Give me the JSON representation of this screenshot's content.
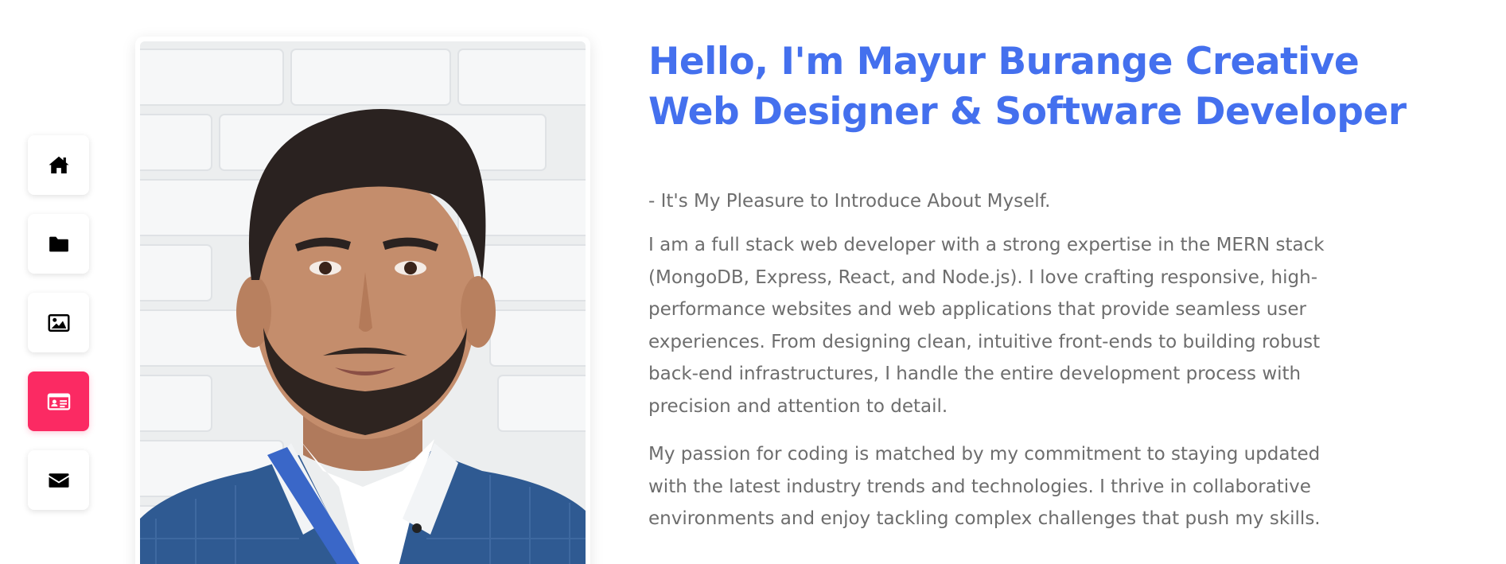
{
  "nav": {
    "items": [
      {
        "icon": "home-icon",
        "active": false
      },
      {
        "icon": "folder-icon",
        "active": false
      },
      {
        "icon": "image-icon",
        "active": false
      },
      {
        "icon": "id-card-icon",
        "active": true
      },
      {
        "icon": "envelope-icon",
        "active": false
      }
    ],
    "accent_color": "#fb2a63"
  },
  "hero": {
    "headline": "Hello, I'm Mayur Burange Creative Web Designer & Software Developer",
    "intro": "- It's My Pleasure to Introduce About Myself.",
    "paragraph_1": "I am a full stack web developer with a strong expertise in the MERN stack (MongoDB, Express, React, and Node.js). I love crafting responsive, high-performance websites and web applications that provide seamless user experiences. From designing clean, intuitive front-ends to building robust back-end infrastructures, I handle the entire development process with precision and attention to detail.",
    "paragraph_2": "My passion for coding is matched by my commitment to staying updated with the latest industry trends and technologies. I thrive in collaborative environments and enjoy tackling complex challenges that push my skills.",
    "headline_color": "#4470ee",
    "text_color": "#6d6d6d"
  }
}
